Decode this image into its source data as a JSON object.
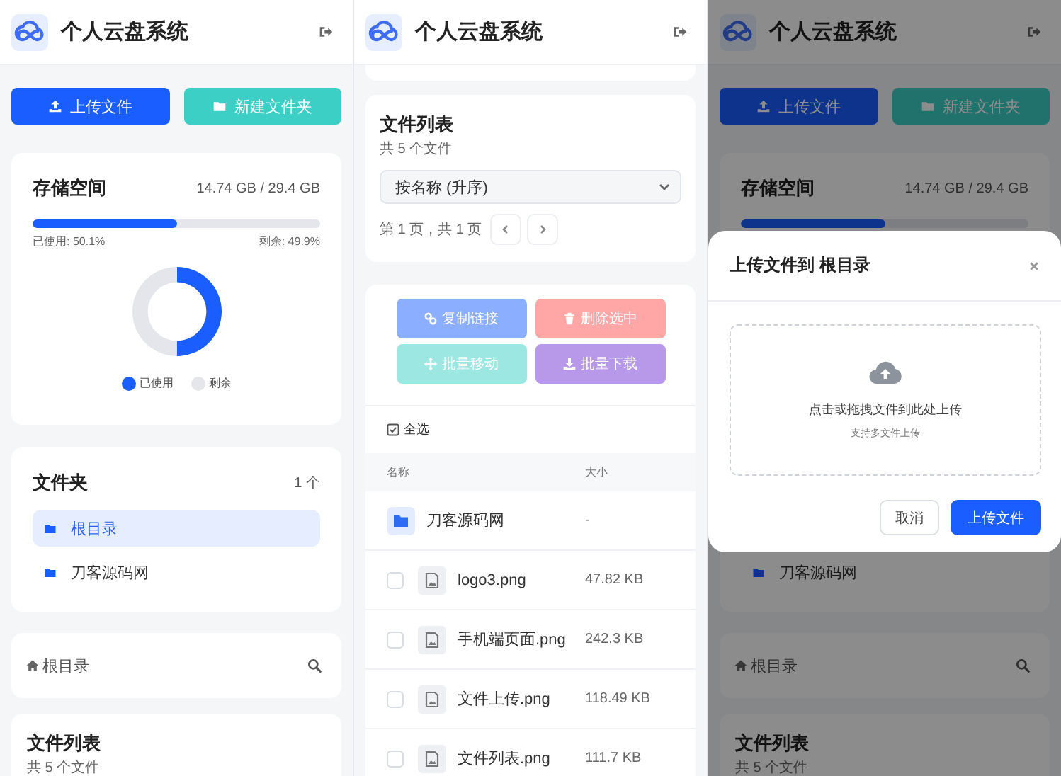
{
  "screens": [
    {
      "header": {
        "title": "个人云盘系统"
      },
      "actions": [
        {
          "label": "上传文件",
          "kind": "upload"
        },
        {
          "label": "新建文件夹",
          "kind": "folder"
        }
      ],
      "storage": {
        "title": "存储空间",
        "usage": "14.74 GB / 29.4 GB",
        "level": 0.501,
        "used_label": "已使用: 50.1%",
        "free_label": "剩余: 49.9%",
        "chart_data": {
          "type": "donut",
          "legend": "bottom",
          "categories": [
            "已使用",
            "剩余"
          ],
          "values": [
            50.1,
            49.9
          ]
        }
      },
      "folders": {
        "title": "文件夹",
        "count": "1 个",
        "items": [
          {
            "name": "根目录",
            "selected": true
          },
          {
            "name": "刀客源码网",
            "selected": false
          }
        ]
      },
      "breadcrumb": {
        "path": "根目录"
      },
      "file_list": {
        "title": "文件列表",
        "count": "共 5 个文件"
      }
    },
    {
      "header": {
        "title": "个人云盘系统"
      },
      "file_list": {
        "title": "文件列表",
        "count": "共 5 个文件",
        "sort": "按名称 (升序)",
        "page_info": "第 1 页，共 1 页"
      },
      "batch": {
        "actions": [
          {
            "label": "复制链接",
            "kind": "link",
            "color": "#8caeff"
          },
          {
            "label": "删除选中",
            "kind": "delete",
            "color": "#ffa6a7"
          },
          {
            "label": "批量移动",
            "kind": "move",
            "color": "#9de7e2"
          },
          {
            "label": "批量下载",
            "kind": "download",
            "color": "#b898e8"
          }
        ],
        "select_all": "全选",
        "columns": [
          "名称",
          "大小"
        ],
        "rows": [
          {
            "kind": "folder",
            "name": "刀客源码网",
            "size": "-"
          },
          {
            "kind": "file",
            "name": "logo3.png",
            "size": "47.82 KB",
            "checked": false
          },
          {
            "kind": "file",
            "name": "手机端页面.png",
            "size": "242.3 KB",
            "checked": false
          },
          {
            "kind": "file",
            "name": "文件上传.png",
            "size": "118.49 KB",
            "checked": false
          },
          {
            "kind": "file",
            "name": "文件列表.png",
            "size": "111.7 KB",
            "checked": false
          }
        ]
      }
    },
    {
      "header": {
        "title": "个人云盘系统"
      },
      "actions": [
        {
          "label": "上传文件",
          "kind": "upload"
        },
        {
          "label": "新建文件夹",
          "kind": "folder"
        }
      ],
      "storage": {
        "title": "存储空间",
        "usage": "14.74 GB / 29.4 GB",
        "level": 0.501
      },
      "folders": {
        "items": [
          {
            "name": "刀客源码网",
            "selected": false
          }
        ]
      },
      "breadcrumb": {
        "path": "根目录"
      },
      "file_list": {
        "title": "文件列表",
        "count": "共 5 个文件"
      },
      "modal": {
        "title": "上传文件到 根目录",
        "drop_text": "点击或拖拽文件到此处上传",
        "drop_hint": "支持多文件上传",
        "buttons": [
          {
            "label": "取消",
            "kind": "secondary"
          },
          {
            "label": "上传文件",
            "kind": "primary"
          }
        ]
      }
    }
  ]
}
